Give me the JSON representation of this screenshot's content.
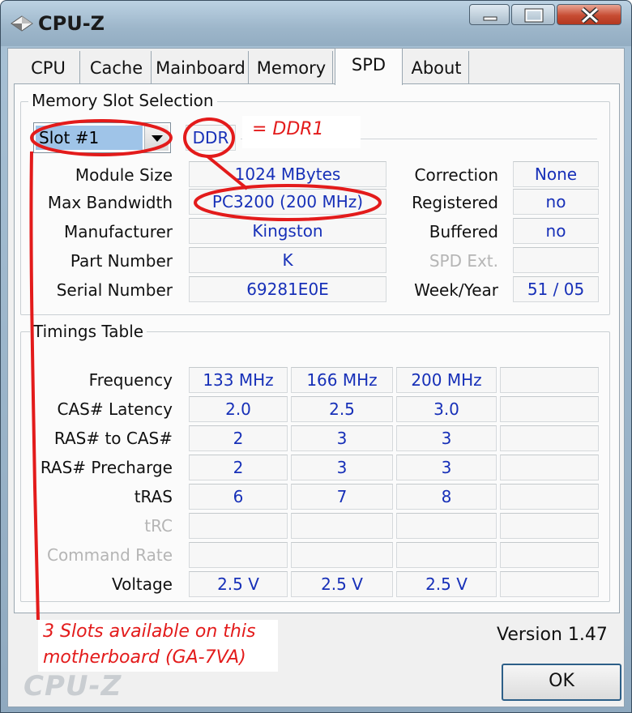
{
  "window": {
    "title": "CPU-Z",
    "icon": "cpu-z-diamond-icon",
    "controls": [
      "minimize-icon",
      "maximize-icon",
      "close-icon"
    ]
  },
  "tabs": [
    {
      "label": "CPU",
      "active": false
    },
    {
      "label": "Cache",
      "active": false
    },
    {
      "label": "Mainboard",
      "active": false
    },
    {
      "label": "Memory",
      "active": false
    },
    {
      "label": "SPD",
      "active": true
    },
    {
      "label": "About",
      "active": false
    }
  ],
  "slot_selection": {
    "title": "Memory Slot Selection",
    "selected_slot": "Slot #1",
    "memory_type": "DDR"
  },
  "module": {
    "labels": {
      "module_size": "Module Size",
      "max_bandwidth": "Max Bandwidth",
      "manufacturer": "Manufacturer",
      "part_number": "Part Number",
      "serial_number": "Serial Number",
      "correction": "Correction",
      "registered": "Registered",
      "buffered": "Buffered",
      "spd_ext": "SPD Ext.",
      "week_year": "Week/Year"
    },
    "values": {
      "module_size": "1024 MBytes",
      "max_bandwidth": "PC3200 (200 MHz)",
      "manufacturer": "Kingston",
      "part_number": "K",
      "serial_number": "69281E0E",
      "correction": "None",
      "registered": "no",
      "buffered": "no",
      "spd_ext": "",
      "week_year": "51 / 05"
    }
  },
  "timings": {
    "title": "Timings Table",
    "rows": [
      {
        "label": "Frequency",
        "enabled": true,
        "values": [
          "133 MHz",
          "166 MHz",
          "200 MHz",
          ""
        ]
      },
      {
        "label": "CAS# Latency",
        "enabled": true,
        "values": [
          "2.0",
          "2.5",
          "3.0",
          ""
        ]
      },
      {
        "label": "RAS# to CAS#",
        "enabled": true,
        "values": [
          "2",
          "3",
          "3",
          ""
        ]
      },
      {
        "label": "RAS# Precharge",
        "enabled": true,
        "values": [
          "2",
          "3",
          "3",
          ""
        ]
      },
      {
        "label": "tRAS",
        "enabled": true,
        "values": [
          "6",
          "7",
          "8",
          ""
        ]
      },
      {
        "label": "tRC",
        "enabled": false,
        "values": [
          "",
          "",
          "",
          ""
        ]
      },
      {
        "label": "Command Rate",
        "enabled": false,
        "values": [
          "",
          "",
          "",
          ""
        ]
      },
      {
        "label": "Voltage",
        "enabled": true,
        "values": [
          "2.5 V",
          "2.5 V",
          "2.5 V",
          ""
        ]
      }
    ]
  },
  "footer": {
    "version": "Version 1.47",
    "ok_label": "OK",
    "watermark": "CPU-Z"
  },
  "annotations": {
    "ddr_note": "= DDR1",
    "slots_note_line1": "3 Slots available on this",
    "slots_note_line2": "motherboard (GA-7VA)",
    "color": "#e31b1b"
  }
}
